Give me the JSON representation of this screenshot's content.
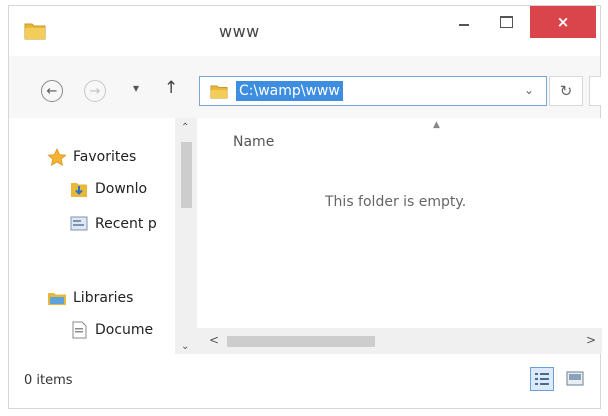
{
  "window": {
    "title": "www"
  },
  "titlebar": {
    "close_glyph": "×"
  },
  "navigation": {
    "back_icon": "back-arrow-icon",
    "forward_icon": "forward-arrow-icon",
    "up_icon": "up-arrow-icon",
    "address": "C:\\wamp\\www"
  },
  "navpane": {
    "items": [
      {
        "label": "Favorites",
        "icon": "star-icon"
      },
      {
        "label": "Downlo",
        "icon": "downloads-icon"
      },
      {
        "label": "Recent p",
        "icon": "recent-places-icon"
      },
      {
        "label": "Libraries",
        "icon": "libraries-icon"
      },
      {
        "label": "Docume",
        "icon": "documents-icon"
      }
    ]
  },
  "content": {
    "column_header": "Name",
    "empty_message": "This folder is empty."
  },
  "statusbar": {
    "item_count": "0 items"
  },
  "colors": {
    "accent": "#3d8ee0",
    "close": "#d9454a",
    "folder": "#e8b83a"
  }
}
